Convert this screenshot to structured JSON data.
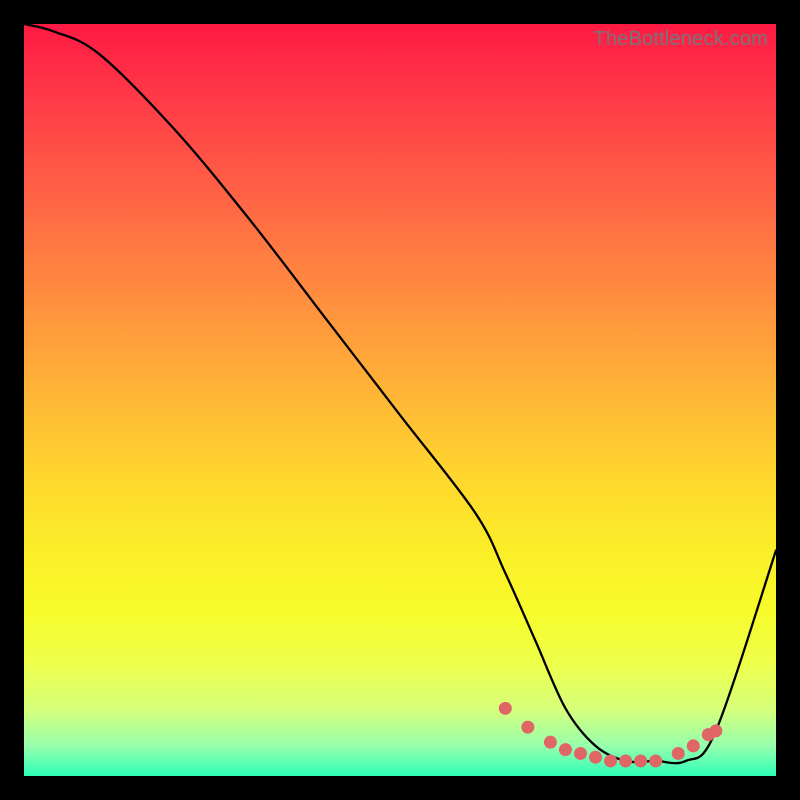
{
  "watermark": "TheBottleneck.com",
  "chart_data": {
    "type": "line",
    "title": "",
    "xlabel": "",
    "ylabel": "",
    "xlim": [
      0,
      100
    ],
    "ylim": [
      0,
      100
    ],
    "series": [
      {
        "name": "bottleneck-curve",
        "x": [
          0,
          4,
          10,
          20,
          30,
          40,
          50,
          60,
          64,
          68,
          72,
          76,
          80,
          84,
          88,
          92,
          100
        ],
        "y": [
          100,
          99,
          96,
          86,
          74,
          61,
          48,
          35,
          27,
          18,
          9,
          4,
          2,
          2,
          2,
          6,
          30
        ]
      }
    ],
    "highlight_points": {
      "name": "basin-dots",
      "x": [
        64,
        67,
        70,
        72,
        74,
        76,
        78,
        80,
        82,
        84,
        87,
        89,
        91,
        92
      ],
      "y": [
        9,
        6.5,
        4.5,
        3.5,
        3,
        2.5,
        2,
        2,
        2,
        2,
        3,
        4,
        5.5,
        6
      ]
    },
    "background": "rainbow-vertical-gradient"
  }
}
